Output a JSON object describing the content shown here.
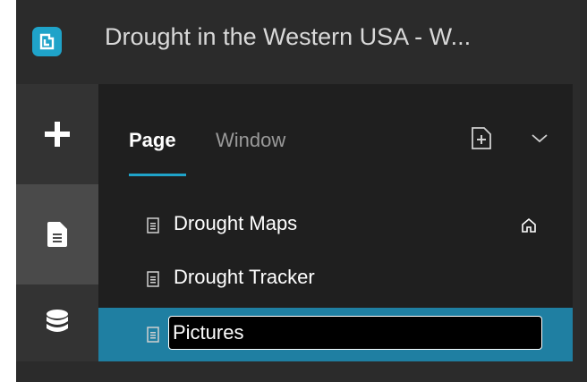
{
  "app": {
    "title": "Drought in the Western USA  - W...",
    "logo_icon": "experience-builder-logo-icon",
    "accent_color": "#1fa3c9",
    "selected_row_color": "#1f7fa2"
  },
  "rail": {
    "items": [
      {
        "name": "add",
        "icon": "plus-icon",
        "active": false
      },
      {
        "name": "page",
        "icon": "page-document-icon",
        "active": true
      },
      {
        "name": "data",
        "icon": "database-icon",
        "active": false
      }
    ]
  },
  "panel": {
    "tabs": [
      {
        "label": "Page",
        "active": true
      },
      {
        "label": "Window",
        "active": false
      }
    ],
    "add_page_icon": "add-page-icon",
    "dropdown_icon": "chevron-down-icon",
    "pages": [
      {
        "label": "Drought Maps",
        "icon": "page-icon",
        "home": true,
        "home_icon": "home-icon"
      },
      {
        "label": "Drought Tracker",
        "icon": "page-icon",
        "home": false
      },
      {
        "label": "",
        "icon": "page-icon",
        "editing": true,
        "input_value": "Pictures"
      }
    ]
  }
}
